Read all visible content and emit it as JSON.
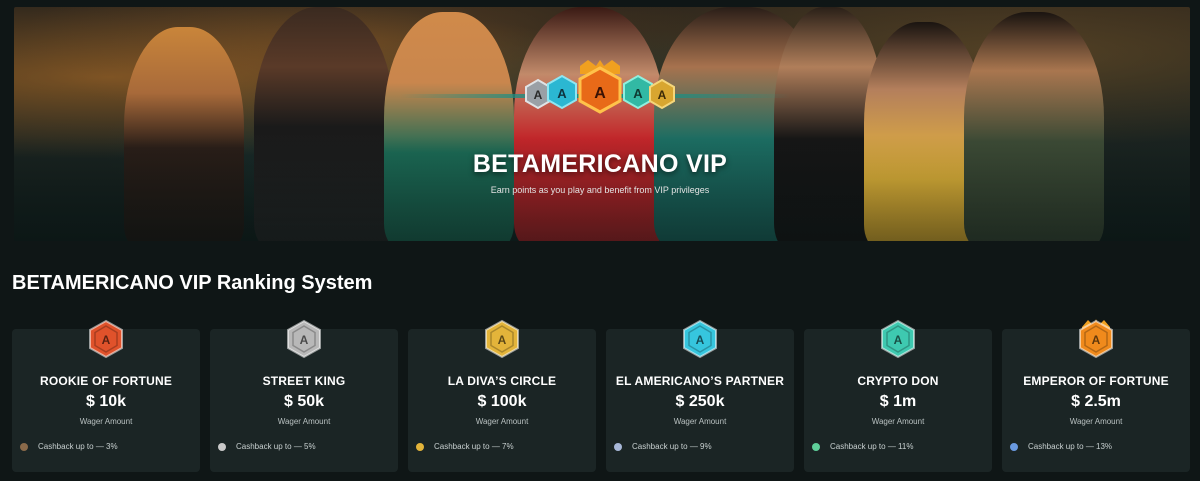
{
  "hero": {
    "title": "BETAMERICANO VIP",
    "subtitle": "Earn points as you play and benefit from VIP privileges",
    "center_badges": [
      "silver-badge-icon",
      "cyan-badge-icon",
      "orange-crown-badge-icon",
      "teal-badge-icon",
      "gold-badge-icon"
    ],
    "badge_letter": "A"
  },
  "section": {
    "title": "BETAMERICANO VIP Ranking System"
  },
  "tiers": [
    {
      "name": "ROOKIE OF FORTUNE",
      "amount": "$ 10k",
      "wager_label": "Wager Amount",
      "perk": "Cashback up to — 3%",
      "badge_color": "#e0522b",
      "dot_color": "#8a6a4a",
      "icon": "rookie-badge-icon"
    },
    {
      "name": "STREET KING",
      "amount": "$ 50k",
      "wager_label": "Wager Amount",
      "perk": "Cashback up to — 5%",
      "badge_color": "#b8b8b8",
      "dot_color": "#c9c9c9",
      "icon": "street-king-badge-icon"
    },
    {
      "name": "LA DIVA’S CIRCLE",
      "amount": "$ 100k",
      "wager_label": "Wager Amount",
      "perk": "Cashback up to — 7%",
      "badge_color": "#e3b43a",
      "dot_color": "#e3b43a",
      "icon": "la-diva-badge-icon"
    },
    {
      "name": "EL AMERICANO’S PARTNER",
      "amount": "$ 250k",
      "wager_label": "Wager Amount",
      "perk": "Cashback up to — 9%",
      "badge_color": "#36c6de",
      "dot_color": "#a8b8d8",
      "icon": "partner-badge-icon"
    },
    {
      "name": "CRYPTO DON",
      "amount": "$ 1m",
      "wager_label": "Wager Amount",
      "perk": "Cashback up to — 11%",
      "badge_color": "#3ec9b0",
      "dot_color": "#5fcf9a",
      "icon": "crypto-don-badge-icon"
    },
    {
      "name": "EMPEROR OF FORTUNE",
      "amount": "$ 2.5m",
      "wager_label": "Wager Amount",
      "perk": "Cashback up to — 13%",
      "badge_color": "#f08a1c",
      "dot_color": "#6a9ae0",
      "icon": "emperor-badge-icon"
    }
  ]
}
